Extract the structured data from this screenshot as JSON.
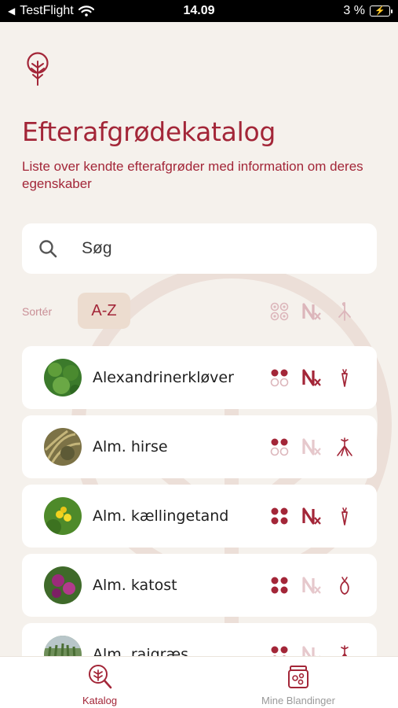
{
  "status_bar": {
    "back_app": "TestFlight",
    "time": "14.09",
    "battery": "3 %"
  },
  "header": {
    "title": "Efterafgrødekatalog",
    "subtitle": "Liste over kendte efterafgrøder med information om deres egenskaber"
  },
  "search": {
    "placeholder": "Søg",
    "value": ""
  },
  "sort": {
    "label": "Sortér",
    "active": "A-Z"
  },
  "colors": {
    "accent": "#a32638",
    "accent_light": "#e2bcc1",
    "background": "#f5f1ec",
    "chip": "#ecdccf"
  },
  "items": [
    {
      "name": "Alexandriner­kløver",
      "frost": "partial",
      "nitrogen": "active",
      "root": "taproot"
    },
    {
      "name": "Alm. hirse",
      "frost": "partial",
      "nitrogen": "inactive",
      "root": "fibrous"
    },
    {
      "name": "Alm. kællingetand",
      "frost": "full",
      "nitrogen": "active",
      "root": "taproot"
    },
    {
      "name": "Alm. katost",
      "frost": "full",
      "nitrogen": "inactive",
      "root": "bulb"
    },
    {
      "name": "Alm. rajgræs",
      "frost": "full",
      "nitrogen": "inactive",
      "root": "fibrous"
    }
  ],
  "tabs": [
    {
      "label": "Katalog",
      "icon": "catalog-search-icon",
      "active": true
    },
    {
      "label": "Mine Blandinger",
      "icon": "mixture-jar-icon",
      "active": false
    }
  ]
}
